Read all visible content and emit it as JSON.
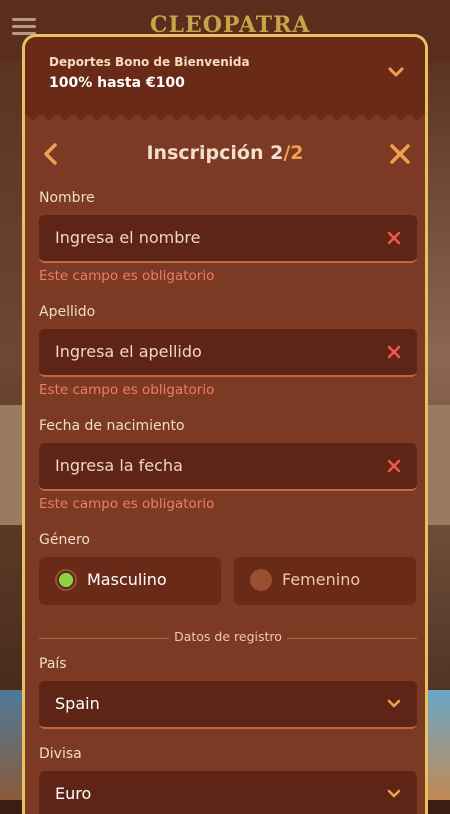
{
  "app": {
    "logo_text": "CLEOPATRA"
  },
  "bonus": {
    "subtitle": "Deportes Bono de Bienvenida",
    "title": "100% hasta €100"
  },
  "header": {
    "title_prefix": "Inscripción 2",
    "title_sep": "/",
    "title_total": "2"
  },
  "fields": [
    {
      "label": "Nombre",
      "placeholder": "Ingresa el nombre",
      "error": "Este campo es obligatorio"
    },
    {
      "label": "Apellido",
      "placeholder": "Ingresa el apellido",
      "error": "Este campo es obligatorio"
    },
    {
      "label": "Fecha de nacimiento",
      "placeholder": "Ingresa la fecha",
      "error": "Este campo es obligatorio"
    }
  ],
  "gender": {
    "label": "Género",
    "options": [
      {
        "label": "Masculino",
        "selected": true
      },
      {
        "label": "Femenino",
        "selected": false
      }
    ]
  },
  "divider_text": "Datos de registro",
  "country": {
    "label": "País",
    "value": "Spain"
  },
  "currency": {
    "label": "Divisa",
    "value": "Euro"
  },
  "colors": {
    "modal_bg": "#7c3a24",
    "gold_border": "#e8c162",
    "accent_orange": "#f0a050",
    "error": "#f07a6a",
    "selected_radio": "#8fd24a"
  }
}
